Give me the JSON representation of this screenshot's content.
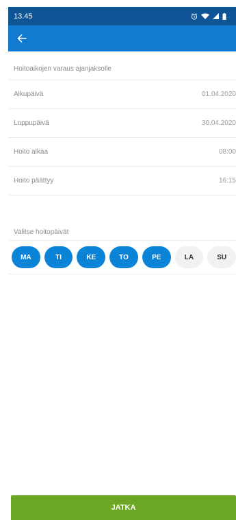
{
  "status_bar": {
    "time": "13.45",
    "icons": [
      "alarm-icon",
      "wifi-icon",
      "signal-icon",
      "battery-icon"
    ]
  },
  "app_bar": {
    "back_icon": "arrow-left-icon"
  },
  "reservation": {
    "title": "Hoitoaikojen varaus ajanjaksolle",
    "rows": [
      {
        "label": "Alkupäivä",
        "value": "01.04.2020"
      },
      {
        "label": "Loppupäivä",
        "value": "30.04.2020"
      },
      {
        "label": "Hoito alkaa",
        "value": "08:00"
      },
      {
        "label": "Hoito päättyy",
        "value": "16:15"
      }
    ]
  },
  "care_days": {
    "title": "Valitse hoitopäivät",
    "days": [
      {
        "label": "MA",
        "selected": true
      },
      {
        "label": "TI",
        "selected": true
      },
      {
        "label": "KE",
        "selected": true
      },
      {
        "label": "TO",
        "selected": true
      },
      {
        "label": "PE",
        "selected": true
      },
      {
        "label": "LA",
        "selected": false
      },
      {
        "label": "SU",
        "selected": false
      }
    ]
  },
  "actions": {
    "continue_label": "JATKA"
  },
  "colors": {
    "status_bar": "#0f5596",
    "app_bar": "#127ad1",
    "day_selected": "#0b84d8",
    "day_unselected": "#f1f1f1",
    "continue_button": "#6ba624"
  }
}
